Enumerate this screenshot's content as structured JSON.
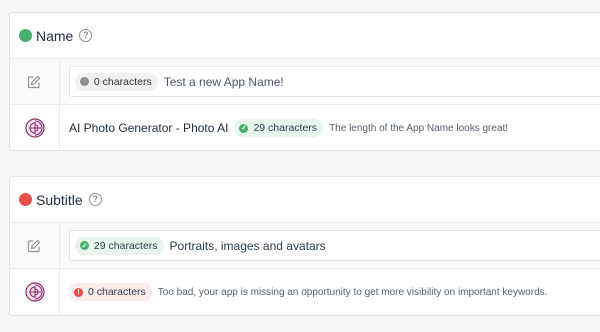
{
  "name_section": {
    "title": "Name",
    "status_color": "#47b06b",
    "help_icon": "?",
    "input": {
      "count_label": "0 characters",
      "status": "neutral",
      "placeholder": "Test a new App Name!"
    },
    "current": {
      "app_name": "AI Photo Generator - Photo AI",
      "count_label": "29 characters",
      "status": "good",
      "message": "The length of the App Name looks great!"
    }
  },
  "subtitle_section": {
    "title": "Subtitle",
    "status_color": "#e9504d",
    "help_icon": "?",
    "input": {
      "count_label": "29 characters",
      "status": "good",
      "value": "Portraits, images and avatars"
    },
    "current": {
      "count_label": "0 characters",
      "status": "bad",
      "message": "Too bad, your app is missing an opportunity to get more visibility on important keywords."
    }
  },
  "icons": {
    "edit": "edit-icon",
    "app": "app-swirl-icon",
    "help": "help-circle-icon"
  },
  "colors": {
    "good": "#46b06a",
    "bad": "#e74c4c",
    "neutral": "#8f8f8f",
    "app_icon": "#8a2a6e"
  }
}
